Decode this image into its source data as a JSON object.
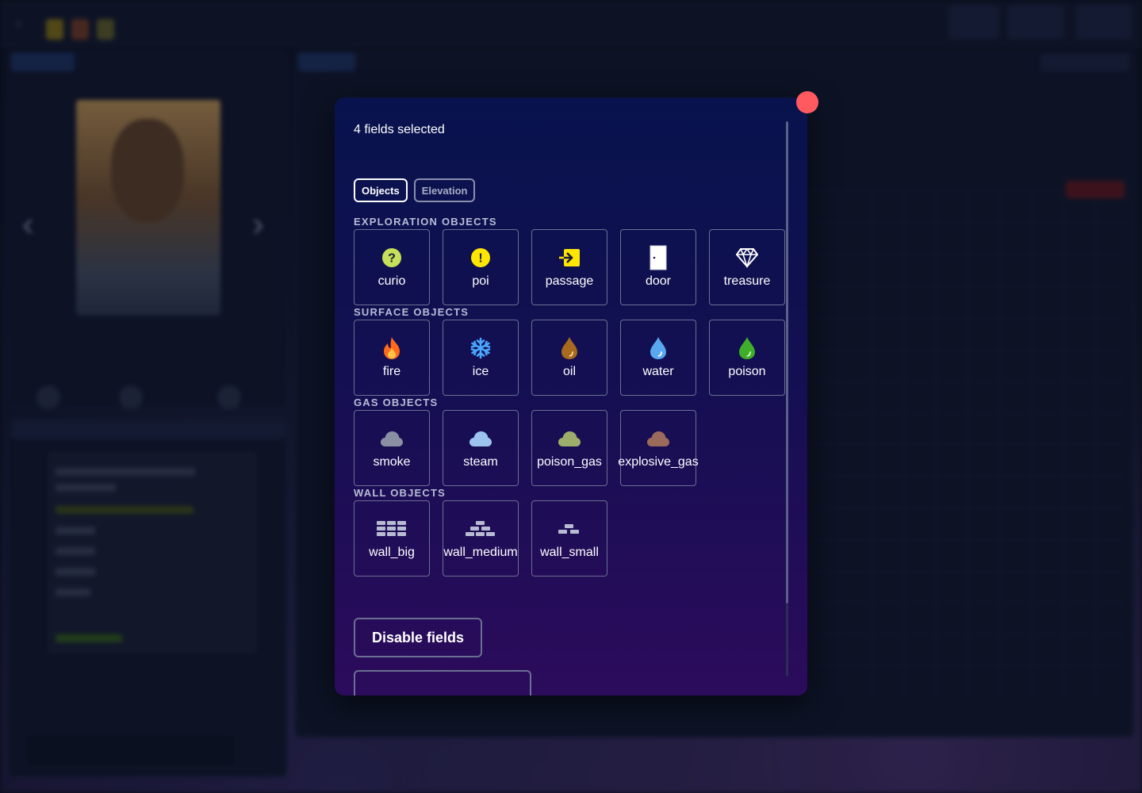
{
  "modal": {
    "selected_text": "4 fields selected",
    "tabs": [
      {
        "label": "Objects",
        "active": true
      },
      {
        "label": "Elevation",
        "active": false
      }
    ],
    "sections": {
      "exploration": {
        "title": "EXPLORATION OBJECTS",
        "items": [
          {
            "label": "curio",
            "icon": "question-mark-circle-icon"
          },
          {
            "label": "poi",
            "icon": "exclamation-circle-icon"
          },
          {
            "label": "passage",
            "icon": "passage-enter-icon"
          },
          {
            "label": "door",
            "icon": "door-icon"
          },
          {
            "label": "treasure",
            "icon": "diamond-icon"
          }
        ]
      },
      "surface": {
        "title": "SURFACE OBJECTS",
        "items": [
          {
            "label": "fire",
            "icon": "flame-icon"
          },
          {
            "label": "ice",
            "icon": "snowflake-icon"
          },
          {
            "label": "oil",
            "icon": "oil-drop-icon"
          },
          {
            "label": "water",
            "icon": "water-drop-icon"
          },
          {
            "label": "poison",
            "icon": "poison-drop-icon"
          }
        ]
      },
      "gas": {
        "title": "GAS OBJECTS",
        "items": [
          {
            "label": "smoke",
            "icon": "smoke-cloud-icon"
          },
          {
            "label": "steam",
            "icon": "steam-cloud-icon"
          },
          {
            "label": "poison_gas",
            "icon": "poison-cloud-icon"
          },
          {
            "label": "explosive_gas",
            "icon": "explosive-cloud-icon"
          }
        ]
      },
      "wall": {
        "title": "WALL OBJECTS",
        "items": [
          {
            "label": "wall_big",
            "icon": "wall-big-icon"
          },
          {
            "label": "wall_medium",
            "icon": "wall-medium-icon"
          },
          {
            "label": "wall_small",
            "icon": "wall-small-icon"
          }
        ]
      }
    },
    "disable_label": "Disable fields"
  },
  "colors": {
    "close": "#ff5a5f",
    "curio": "#c6e05a",
    "poi": "#ffe600",
    "passage": "#ffe600",
    "fire": "#ff7a1a",
    "ice": "#4aa8ff",
    "oil": "#a86a1e",
    "water": "#58a8f0",
    "poison": "#3fae2a",
    "smoke": "#8a8fa4",
    "steam": "#9cc4ee",
    "poison_gas": "#9cae6a",
    "explosive_gas": "#9a6a5a",
    "wall": "#b8bcd2"
  }
}
